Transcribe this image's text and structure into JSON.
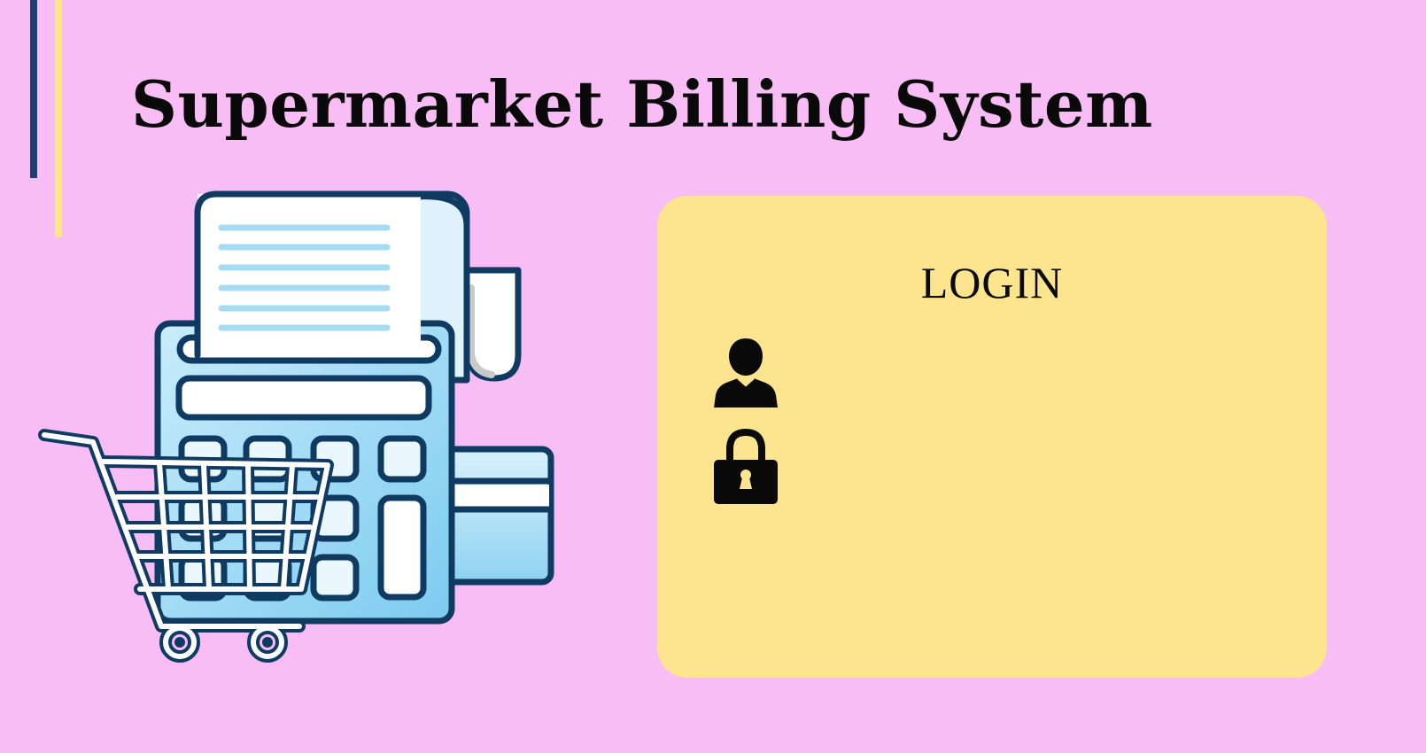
{
  "header": {
    "title": "Supermarket Billing System"
  },
  "login": {
    "heading": "LOGIN",
    "username": {
      "icon": "user-icon",
      "value": "",
      "placeholder": ""
    },
    "password": {
      "icon": "lock-icon",
      "value": "",
      "placeholder": ""
    }
  },
  "colors": {
    "background": "#f9bdf6",
    "card": "#fde58f",
    "accent_dark": "#1b3f73",
    "accent_light": "#fde58f",
    "illustration_outline": "#0f3b62",
    "illustration_fill": "#a9def7"
  },
  "illustration": {
    "icon": "cash-register-cart-illustration"
  }
}
